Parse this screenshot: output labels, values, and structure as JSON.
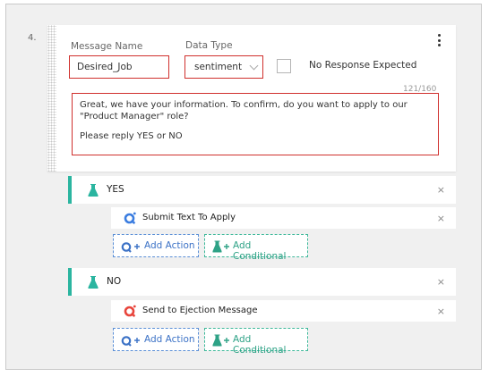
{
  "step": {
    "number": "4."
  },
  "message_block": {
    "name_label": "Message Name",
    "name_value": "Desired_Job",
    "type_label": "Data Type",
    "type_value": "sentiment",
    "no_response_label": "No Response Expected",
    "no_response_checked": false,
    "char_counter": "121/160",
    "message_line1": "Great, we have your information. To confirm, do you want to apply to our \"Product Manager\" role?",
    "message_line2": "Please reply YES or NO"
  },
  "branches": [
    {
      "label": "YES",
      "close": "×",
      "action_label": "Submit Text To Apply",
      "action_close": "×",
      "add_action_label": "Add Action",
      "add_conditional_label": "Add Conditional"
    },
    {
      "label": "NO",
      "close": "×",
      "action_label": "Send to Ejection Message",
      "action_close": "×",
      "add_action_label": "Add Action",
      "add_conditional_label": "Add Conditional"
    }
  ],
  "colors": {
    "highlight_border": "#d0302d",
    "branch_accent": "#2bb5a0",
    "action_blue": "#3c72c6",
    "conditional_green": "#2ea286",
    "action_icon_red": "#e8453c",
    "action_icon_blue": "#3b7de0"
  },
  "icons": {
    "branch": "flask-icon",
    "action_yes": "q-bubble-icon-blue",
    "action_no": "q-bubble-icon-red",
    "menu": "kebab-menu-icon"
  }
}
